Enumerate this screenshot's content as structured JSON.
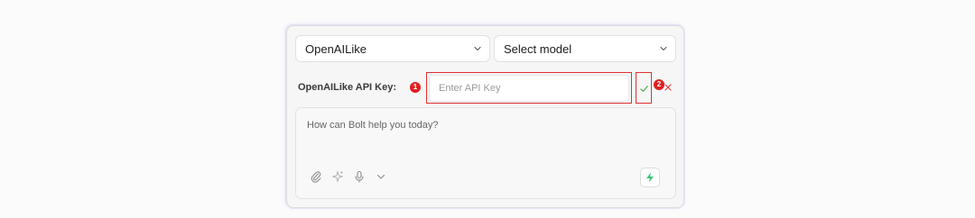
{
  "provider_select": {
    "value": "OpenAILike"
  },
  "model_select": {
    "value": "Select model"
  },
  "api_key": {
    "label": "OpenAILike API Key:",
    "placeholder": "Enter API Key"
  },
  "annotations": {
    "badge_1": "1",
    "badge_2": "2"
  },
  "chat": {
    "placeholder": "How can Bolt help you today?"
  },
  "colors": {
    "accent_send": "#3cc37a",
    "highlight": "#e03030",
    "confirm_check": "#4caf50"
  },
  "icons": [
    "chevron-down-icon",
    "check-icon",
    "close-icon",
    "paperclip-icon",
    "sparkle-icon",
    "microphone-icon",
    "lightning-icon"
  ]
}
